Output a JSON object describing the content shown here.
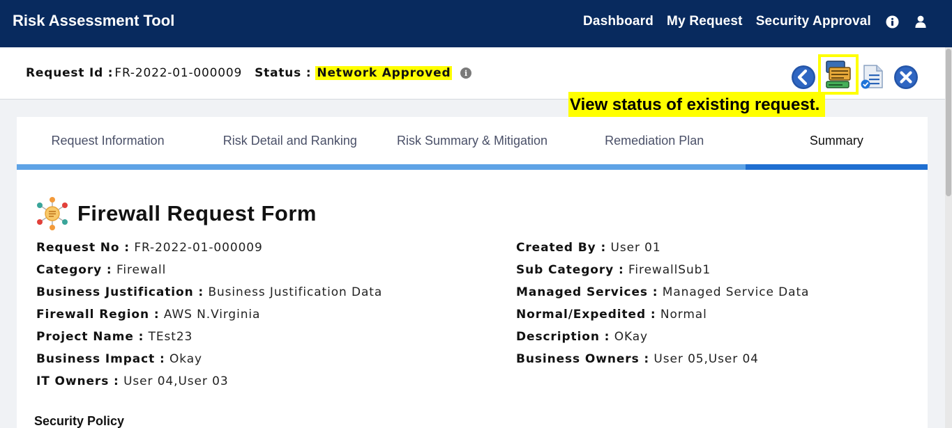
{
  "app": {
    "title": "Risk Assessment Tool"
  },
  "nav": {
    "links": [
      "Dashboard",
      "My Request",
      "Security Approval"
    ],
    "icons": [
      "info-icon",
      "user-icon"
    ]
  },
  "request": {
    "id_label": "Request Id :",
    "id_value": "FR-2022-01-000009",
    "status_label": "Status :",
    "status_value": "Network Approved"
  },
  "actions": {
    "buttons": [
      "back-icon",
      "view-status-icon",
      "document-icon",
      "close-icon"
    ],
    "highlight_color": "#ffff00"
  },
  "callout": {
    "text": "View status of existing request."
  },
  "tabs": {
    "items": [
      "Request Information",
      "Risk Detail and Ranking",
      "Risk Summary & Mitigation",
      "Remediation Plan",
      "Summary"
    ],
    "active": "Summary"
  },
  "form": {
    "title": "Firewall Request Form",
    "left": [
      {
        "label": "Request No :",
        "value": "FR-2022-01-000009"
      },
      {
        "label": "Category :",
        "value": "Firewall"
      },
      {
        "label": "Business Justification :",
        "value": "Business Justification Data"
      },
      {
        "label": "Firewall Region :",
        "value": "AWS N.Virginia"
      },
      {
        "label": "Project Name :",
        "value": "TEst23"
      },
      {
        "label": "Business Impact :",
        "value": "Okay"
      },
      {
        "label": "IT Owners :",
        "value": "User 04,User 03"
      }
    ],
    "right": [
      {
        "label": "Created By :",
        "value": "User 01"
      },
      {
        "label": "Sub Category :",
        "value": "FirewallSub1"
      },
      {
        "label": "Managed Services :",
        "value": "Managed Service Data"
      },
      {
        "label": "Normal/Expedited :",
        "value": "Normal"
      },
      {
        "label": "Description :",
        "value": "OKay"
      },
      {
        "label": "Business Owners :",
        "value": "User 05,User 04"
      }
    ],
    "section_title": "Security Policy"
  },
  "colors": {
    "nav_bg": "#082a5e",
    "progress": "#5ea3e6",
    "progress_active": "#1f6fd1",
    "highlight": "#ffff00"
  }
}
